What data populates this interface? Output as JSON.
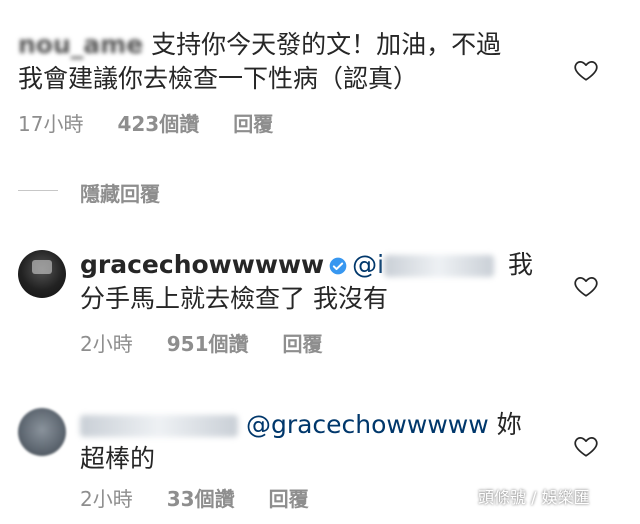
{
  "comment1": {
    "username": "nou_ame",
    "text_line1": "支持你今天發的文！加油，不過",
    "text_line2": "我會建議你去檢查一下性病（認真）",
    "time": "17小時",
    "likes": "423個讚",
    "reply": "回覆"
  },
  "hide_replies": "隱藏回覆",
  "comment2": {
    "username": "gracechowwwww",
    "mention": "@i",
    "text_line1_end": "我",
    "text_line2": "分手馬上就去檢查了 我沒有",
    "time": "2小時",
    "likes": "951個讚",
    "reply": "回覆"
  },
  "comment3": {
    "mention": "@gracechowwwww",
    "text_line1_end": "妳",
    "text_line2": "超棒的",
    "time": "2小時",
    "likes": "33個讚",
    "reply": "回覆"
  },
  "watermark": "頭條號 / 娛樂匯",
  "colors": {
    "text": "#262626",
    "meta": "#8e8e8e",
    "mention": "#00376b",
    "verified": "#3897f0"
  },
  "icons": [
    "heart-icon",
    "verified-badge-icon"
  ]
}
